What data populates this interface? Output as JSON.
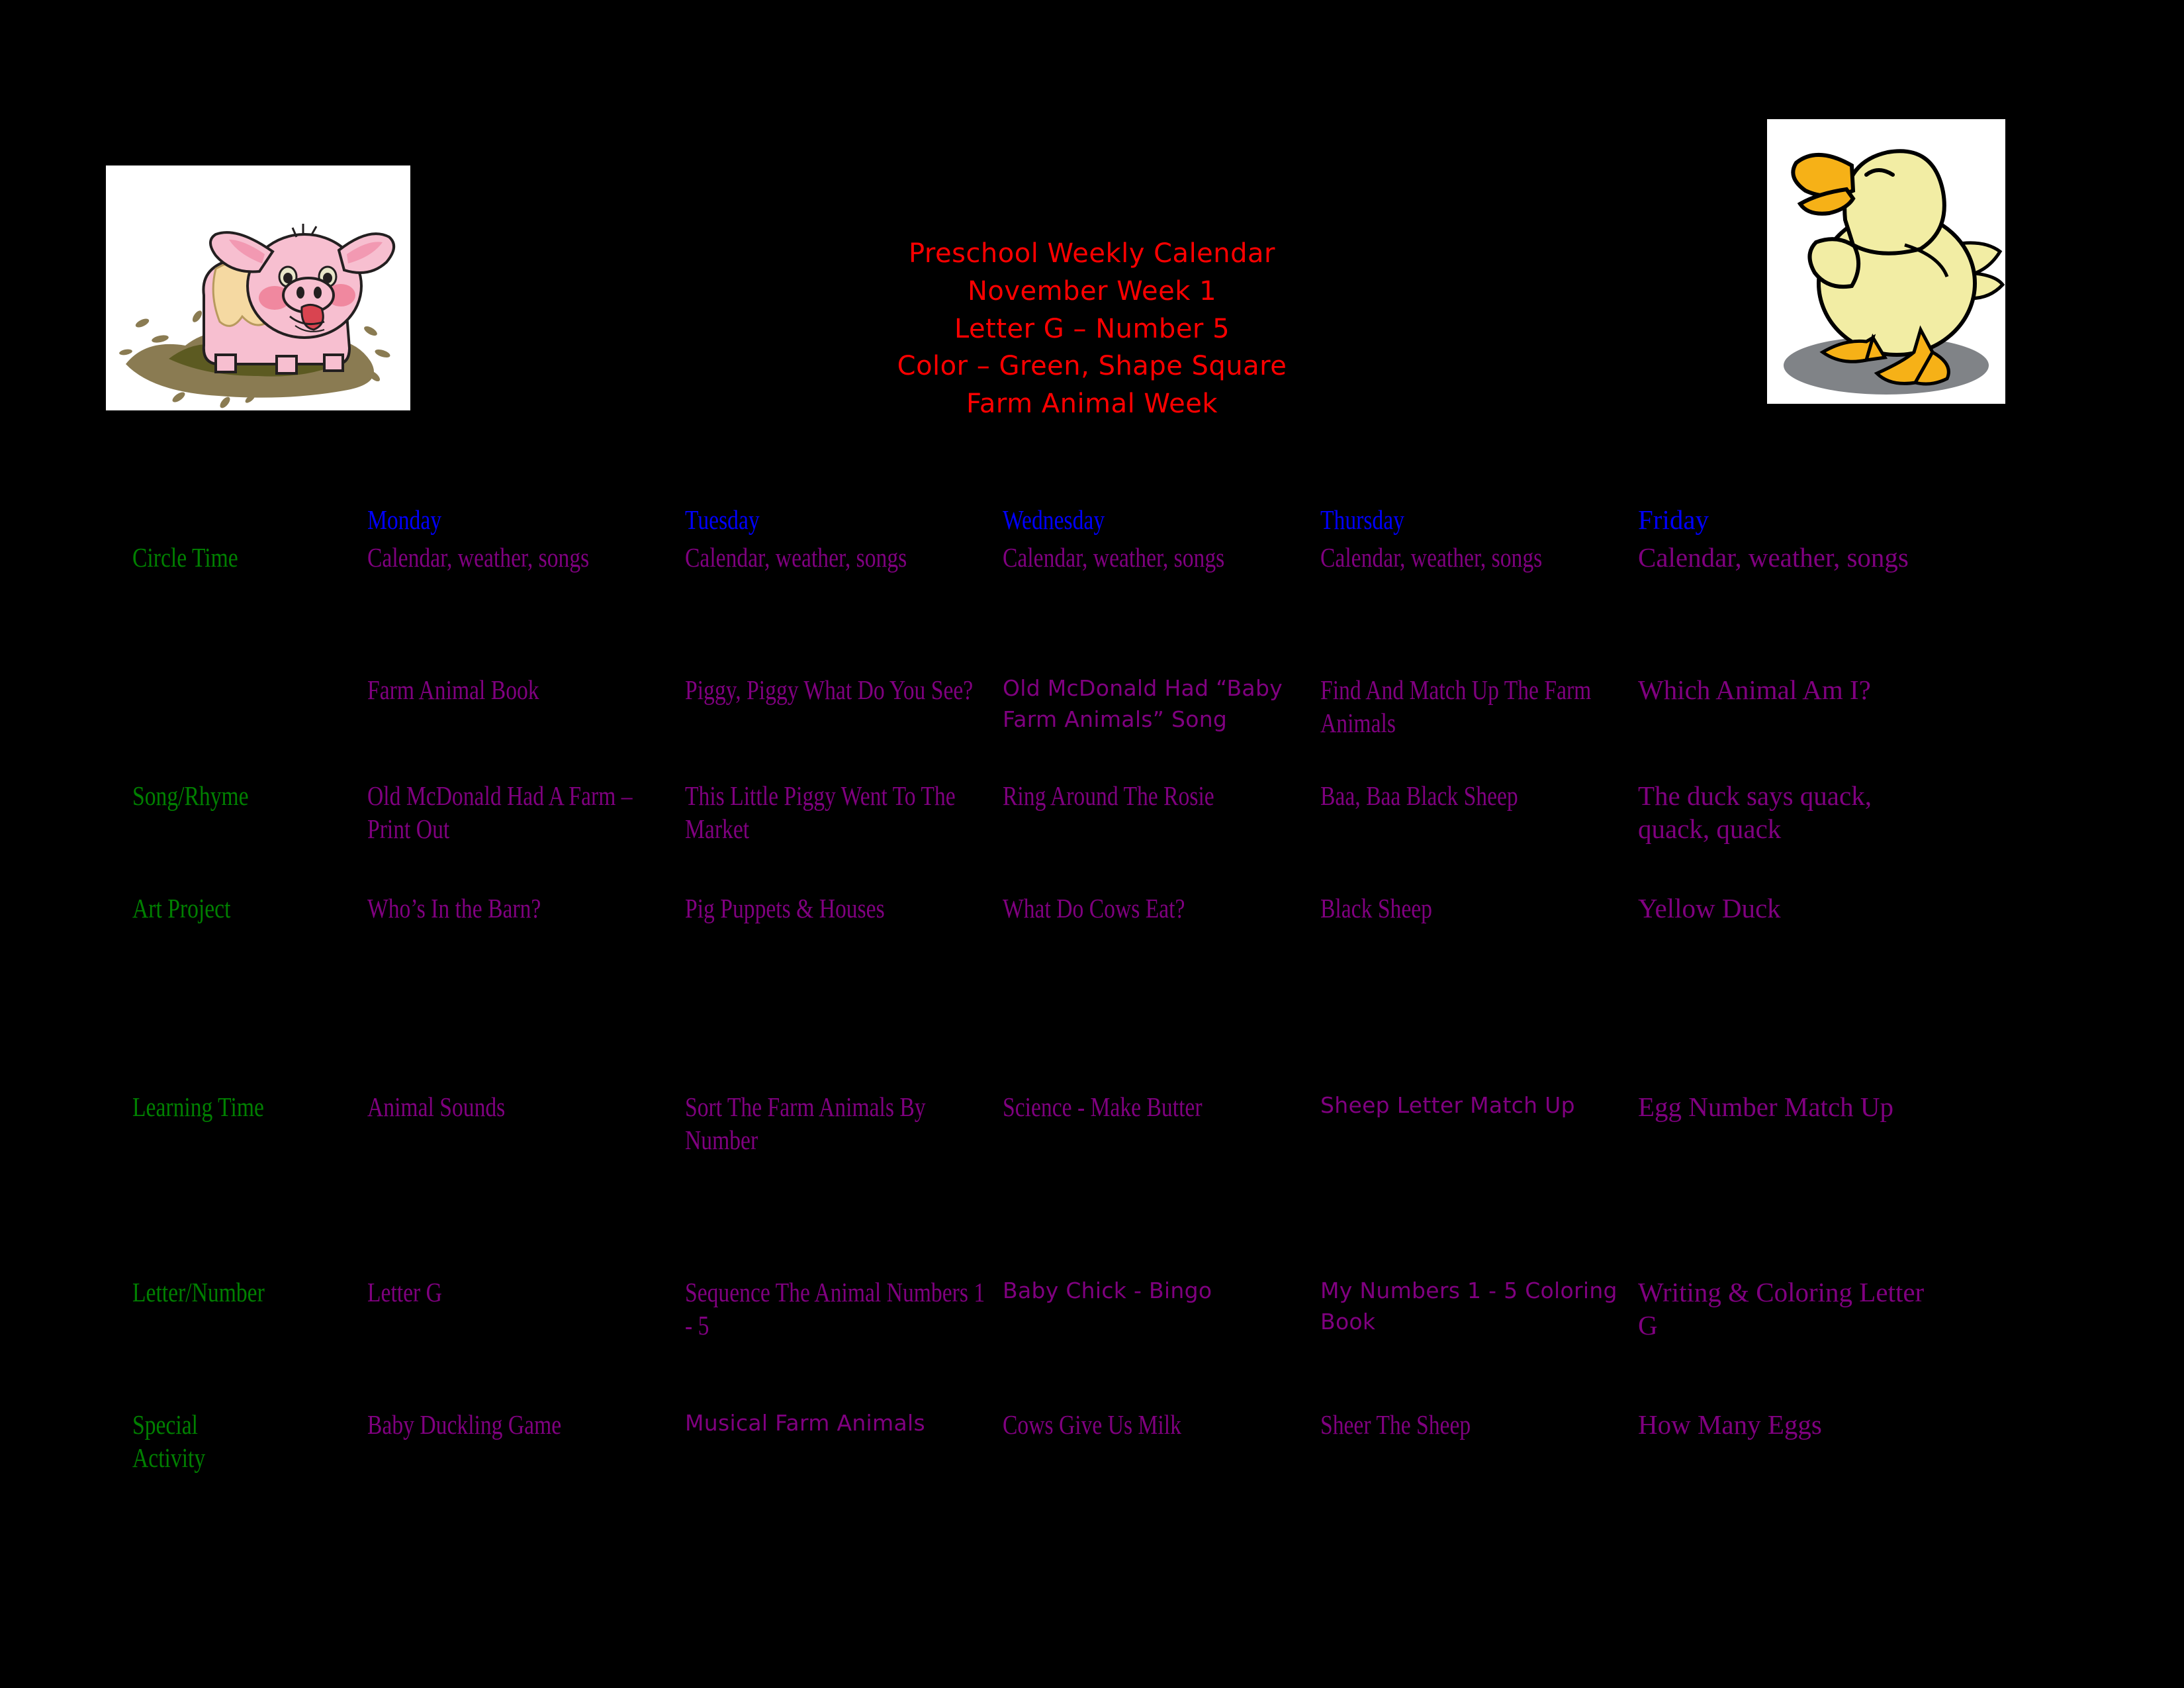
{
  "colors": {
    "background": "#000000",
    "title": "#FF0000",
    "day_header": "#0000FF",
    "row_label": "#008000",
    "cell_text": "#800080"
  },
  "title": {
    "lines": [
      "Preschool Weekly Calendar",
      "November Week 1",
      "Letter G – Number 5",
      "Color – Green, Shape Square",
      "Farm Animal Week"
    ]
  },
  "images": {
    "left": {
      "name": "pig-in-mud-clipart",
      "alt": "Cartoon pink pig playing in a mud puddle"
    },
    "right": {
      "name": "yellow-duckling-clipart",
      "alt": "Cartoon yellow duckling walking"
    }
  },
  "calendar": {
    "day_headers": [
      "Monday",
      "Tuesday",
      "Wednesday",
      "Thursday",
      "Friday"
    ],
    "row_labels": [
      "Circle Time",
      "",
      "Song/Rhyme",
      "Art Project",
      "Learning Time",
      "Letter/Number",
      "Special\nActivity"
    ],
    "rows": [
      {
        "label": "Circle Time",
        "cells": [
          "Calendar, weather, songs",
          "Calendar, weather, songs",
          "Calendar, weather, songs",
          "Calendar, weather, songs",
          "Calendar, weather, songs"
        ]
      },
      {
        "label": "",
        "cells": [
          "Farm Animal Book",
          "Piggy, Piggy What Do You See?",
          "Old McDonald Had “Baby Farm Animals” Song",
          "Find And Match Up The Farm Animals",
          "Which Animal Am I?"
        ]
      },
      {
        "label": "Song/Rhyme",
        "cells": [
          "Old McDonald Had A Farm – Print Out",
          "This Little Piggy Went To The Market",
          "Ring Around The Rosie",
          "Baa, Baa Black Sheep",
          "The duck says quack, quack, quack"
        ]
      },
      {
        "label": "Art Project",
        "cells": [
          "Who’s In the Barn?",
          "Pig Puppets & Houses",
          "What Do Cows Eat?",
          "Black Sheep",
          "Yellow Duck"
        ]
      },
      {
        "label": "Learning Time",
        "cells": [
          "Animal Sounds",
          "Sort The Farm Animals By Number",
          "Science - Make Butter",
          "Sheep Letter Match Up",
          "Egg Number Match Up"
        ]
      },
      {
        "label": "Letter/Number",
        "cells": [
          "Letter G",
          "Sequence  The Animal Numbers 1 - 5",
          "Baby Chick - Bingo",
          "My Numbers 1 - 5 Coloring Book",
          "Writing & Coloring Letter G"
        ]
      },
      {
        "label": "Special Activity",
        "cells": [
          "Baby Duckling Game",
          "Musical Farm Animals",
          "Cows Give Us Milk",
          "Sheer The Sheep",
          "How Many Eggs"
        ]
      }
    ]
  }
}
